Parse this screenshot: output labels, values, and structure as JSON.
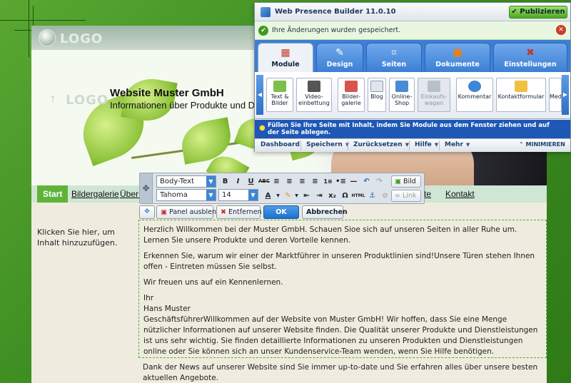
{
  "site": {
    "logo_text": "LOGO",
    "hero_logo_text": "LOGO",
    "title": "Website Muster GmbH",
    "subtitle": "Informationen über Produkte und Dienstleistungen"
  },
  "nav": {
    "items": [
      {
        "label": "Start",
        "active": true
      },
      {
        "label": "Bildergalerie"
      },
      {
        "label": "Über uns"
      },
      {
        "label": "Produkte"
      },
      {
        "label": "Kontakt"
      }
    ]
  },
  "content": {
    "sidebar_placeholder": "Klicken Sie hier, um Inhalt hinzuzufügen.",
    "paragraphs": [
      "Herzlich Willkommen bei der Muster GmbH. Schauen Sioe sich auf unseren Seiten in aller Ruhe um. Lernen Sie unsere Produkte und deren Vorteile kennen.",
      "Erkennen Sie, warum wir einer der Marktführer in unseren Produktlinien sind!Unsere Türen stehen Ihnen offen - Eintreten müssen Sie selbst.",
      "Wir freuen uns auf ein Kennenlernen.",
      "Ihr",
      "Hans Muster",
      "GeschäftsführerWillkommen auf der Website von Muster GmbH! Wir hoffen, dass Sie eine Menge nützlicher Informationen auf unserer Website finden. Die Qualität unserer Produkte und Dienstleistungen ist uns sehr wichtig. Sie finden detaillierte Informationen zu unseren Produkten und Dienstleistungen online oder Sie können sich an unser Kundenservice-Team wenden, wenn Sie Hilfe benötigen."
    ],
    "news": "Dank der News auf unserer Website sind Sie immer up-to-date und Sie erfahren alles über unsere besten aktuellen Angebote."
  },
  "editor": {
    "style_select": "Body-Text",
    "font_select": "Tahoma",
    "size_select": "14",
    "bold": "B",
    "italic": "I",
    "underline": "U",
    "strike": "ABC",
    "omega": "Ω",
    "html": "HTML",
    "image_button": "Bild",
    "link_button": "Link",
    "hide_panel": "Panel ausblenden",
    "remove": "Entfernen",
    "ok": "OK",
    "cancel": "Abbrechen"
  },
  "wpb": {
    "title": "Web Presence Builder 11.0.10",
    "publish": "Publizieren",
    "notice": "Ihre Änderungen wurden gespeichert.",
    "tabs": [
      {
        "label": "Module",
        "active": true
      },
      {
        "label": "Design"
      },
      {
        "label": "Seiten"
      },
      {
        "label": "Dokumente"
      },
      {
        "label": "Einstellungen"
      }
    ],
    "modules": [
      {
        "label": "Text & Bilder"
      },
      {
        "label": "Video-einbettung"
      },
      {
        "label": "Bilder-galerie"
      },
      {
        "label": "Blog"
      },
      {
        "label": "Online-Shop"
      },
      {
        "label": "Einkaufs-wagen",
        "disabled": true
      },
      {
        "label": "Kommentar"
      },
      {
        "label": "Kontaktformular"
      },
      {
        "label": "Med"
      }
    ],
    "hint": "Füllen Sie Ihre Seite mit Inhalt, indem Sie Module aus dem Fenster ziehen und auf der Seite ablegen.",
    "menu": {
      "dashboard": "Dashboard",
      "save": "Speichern",
      "reset": "Zurücksetzen",
      "help": "Hilfe",
      "more": "Mehr",
      "minimize": "MINIMIEREN"
    }
  },
  "colors": {
    "accent_green": "#5fb339",
    "accent_blue": "#3c7fd4",
    "content_bg": "#f0ebdf"
  }
}
